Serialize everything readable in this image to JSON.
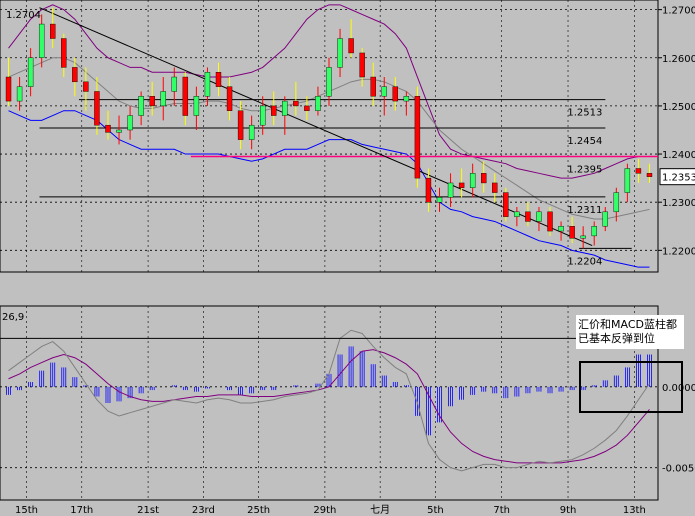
{
  "chart_data": [
    {
      "type": "candlestick",
      "panel": "price",
      "ylim": [
        1.2155,
        1.272
      ],
      "yticks": [
        "1.2700",
        "1.2600",
        "1.2500",
        "1.2400",
        "1.2300",
        "1.2200"
      ],
      "xticks": [
        "15th",
        "17th",
        "21st",
        "23rd",
        "25th",
        "29th",
        "七月",
        "5th",
        "7th",
        "9th",
        "13th"
      ],
      "candles": [
        [
          1.256,
          1.26,
          1.25,
          1.251
        ],
        [
          1.251,
          1.256,
          1.249,
          1.254
        ],
        [
          1.254,
          1.262,
          1.252,
          1.26
        ],
        [
          1.26,
          1.269,
          1.258,
          1.267
        ],
        [
          1.267,
          1.2704,
          1.262,
          1.264
        ],
        [
          1.264,
          1.265,
          1.256,
          1.258
        ],
        [
          1.258,
          1.26,
          1.252,
          1.255
        ],
        [
          1.255,
          1.258,
          1.249,
          1.253
        ],
        [
          1.253,
          1.256,
          1.244,
          1.246
        ],
        [
          1.246,
          1.249,
          1.243,
          1.2445
        ],
        [
          1.2445,
          1.248,
          1.242,
          1.245
        ],
        [
          1.245,
          1.25,
          1.243,
          1.248
        ],
        [
          1.248,
          1.253,
          1.246,
          1.252
        ],
        [
          1.252,
          1.255,
          1.248,
          1.25
        ],
        [
          1.25,
          1.256,
          1.247,
          1.253
        ],
        [
          1.253,
          1.258,
          1.25,
          1.256
        ],
        [
          1.256,
          1.257,
          1.246,
          1.248
        ],
        [
          1.248,
          1.254,
          1.245,
          1.252
        ],
        [
          1.252,
          1.258,
          1.25,
          1.257
        ],
        [
          1.257,
          1.259,
          1.252,
          1.254
        ],
        [
          1.254,
          1.256,
          1.247,
          1.249
        ],
        [
          1.249,
          1.251,
          1.241,
          1.243
        ],
        [
          1.243,
          1.248,
          1.241,
          1.246
        ],
        [
          1.246,
          1.252,
          1.244,
          1.25
        ],
        [
          1.25,
          1.253,
          1.246,
          1.248
        ],
        [
          1.248,
          1.252,
          1.244,
          1.251
        ],
        [
          1.251,
          1.255,
          1.248,
          1.25
        ],
        [
          1.25,
          1.252,
          1.247,
          1.249
        ],
        [
          1.249,
          1.254,
          1.248,
          1.252
        ],
        [
          1.252,
          1.26,
          1.25,
          1.258
        ],
        [
          1.258,
          1.266,
          1.256,
          1.264
        ],
        [
          1.264,
          1.268,
          1.26,
          1.261
        ],
        [
          1.261,
          1.262,
          1.254,
          1.256
        ],
        [
          1.256,
          1.259,
          1.25,
          1.252
        ],
        [
          1.252,
          1.256,
          1.248,
          1.254
        ],
        [
          1.254,
          1.256,
          1.249,
          1.251
        ],
        [
          1.251,
          1.253,
          1.248,
          1.252
        ],
        [
          1.252,
          1.254,
          1.233,
          1.235
        ],
        [
          1.235,
          1.237,
          1.228,
          1.23
        ],
        [
          1.23,
          1.233,
          1.228,
          1.231
        ],
        [
          1.231,
          1.236,
          1.229,
          1.234
        ],
        [
          1.234,
          1.237,
          1.231,
          1.233
        ],
        [
          1.233,
          1.238,
          1.231,
          1.236
        ],
        [
          1.236,
          1.2385,
          1.232,
          1.234
        ],
        [
          1.234,
          1.236,
          1.23,
          1.232
        ],
        [
          1.232,
          1.233,
          1.226,
          1.227
        ],
        [
          1.227,
          1.229,
          1.225,
          1.228
        ],
        [
          1.228,
          1.23,
          1.225,
          1.226
        ],
        [
          1.226,
          1.229,
          1.224,
          1.228
        ],
        [
          1.228,
          1.229,
          1.223,
          1.224
        ],
        [
          1.224,
          1.226,
          1.222,
          1.225
        ],
        [
          1.225,
          1.227,
          1.2215,
          1.2225
        ],
        [
          1.2225,
          1.225,
          1.2204,
          1.223
        ],
        [
          1.223,
          1.226,
          1.221,
          1.225
        ],
        [
          1.225,
          1.229,
          1.224,
          1.228
        ],
        [
          1.228,
          1.233,
          1.226,
          1.232
        ],
        [
          1.232,
          1.238,
          1.23,
          1.237
        ],
        [
          1.237,
          1.239,
          1.234,
          1.236
        ],
        [
          1.236,
          1.238,
          1.234,
          1.2353
        ]
      ],
      "bollinger_upper": [
        1.262,
        1.265,
        1.268,
        1.27,
        1.271,
        1.27,
        1.268,
        1.265,
        1.262,
        1.26,
        1.259,
        1.258,
        1.258,
        1.257,
        1.257,
        1.257,
        1.257,
        1.2565,
        1.256,
        1.256,
        1.256,
        1.2565,
        1.257,
        1.258,
        1.26,
        1.262,
        1.265,
        1.268,
        1.27,
        1.271,
        1.271,
        1.27,
        1.269,
        1.268,
        1.267,
        1.265,
        1.262,
        1.256,
        1.25,
        1.244,
        1.241,
        1.24,
        1.2395,
        1.239,
        1.2385,
        1.238,
        1.237,
        1.2365,
        1.236,
        1.2355,
        1.235,
        1.235,
        1.2355,
        1.236,
        1.237,
        1.238,
        1.239,
        1.2395,
        1.2395
      ],
      "bollinger_middle": [
        1.256,
        1.257,
        1.258,
        1.259,
        1.26,
        1.26,
        1.259,
        1.257,
        1.255,
        1.253,
        1.251,
        1.25,
        1.2495,
        1.2495,
        1.25,
        1.2505,
        1.2505,
        1.2505,
        1.251,
        1.251,
        1.2505,
        1.2495,
        1.249,
        1.249,
        1.2495,
        1.25,
        1.2505,
        1.251,
        1.252,
        1.253,
        1.254,
        1.255,
        1.2555,
        1.2555,
        1.255,
        1.254,
        1.253,
        1.251,
        1.248,
        1.245,
        1.243,
        1.241,
        1.2395,
        1.238,
        1.2365,
        1.235,
        1.2335,
        1.232,
        1.2305,
        1.2295,
        1.2285,
        1.2275,
        1.227,
        1.2265,
        1.2265,
        1.227,
        1.2275,
        1.228,
        1.2285
      ],
      "bollinger_lower": [
        1.249,
        1.248,
        1.247,
        1.247,
        1.248,
        1.249,
        1.249,
        1.248,
        1.247,
        1.245,
        1.243,
        1.242,
        1.241,
        1.241,
        1.241,
        1.241,
        1.24,
        1.24,
        1.24,
        1.24,
        1.2395,
        1.239,
        1.2385,
        1.239,
        1.24,
        1.241,
        1.241,
        1.241,
        1.242,
        1.243,
        1.243,
        1.243,
        1.242,
        1.2415,
        1.241,
        1.2405,
        1.24,
        1.238,
        1.234,
        1.23,
        1.2285,
        1.228,
        1.227,
        1.2265,
        1.226,
        1.225,
        1.224,
        1.223,
        1.222,
        1.2215,
        1.221,
        1.22,
        1.2195,
        1.219,
        1.218,
        1.2175,
        1.217,
        1.2165,
        1.2165
      ],
      "hlines": [
        {
          "value": 1.2513,
          "label": "1.2513",
          "from": 0.12,
          "to": 0.92
        },
        {
          "value": 1.2454,
          "label": "1.2454",
          "from": 0.06,
          "to": 0.92
        },
        {
          "value": 1.2395,
          "label": "1.2395",
          "from": 0.29,
          "to": 1.0
        },
        {
          "value": 1.2311,
          "label": "1.2311",
          "from": 0.06,
          "to": 0.92
        },
        {
          "value": 1.2204,
          "label": "1.2204",
          "from": 0.88,
          "to": 0.96
        }
      ],
      "trendline": {
        "x1": 0.06,
        "y1": 1.2704,
        "x2": 0.9,
        "y2": 1.221
      },
      "high_label": "1.2704",
      "last_price_label": "1.2353",
      "colors": {
        "bull": "#ff0000",
        "bear": "#ffff00",
        "bull_body": "#33ff66",
        "upper": "#800080",
        "middle": "#808080",
        "lower": "#0000ff",
        "resistance": "#ff0080"
      }
    },
    {
      "type": "macd",
      "panel": "macd",
      "ylim": [
        -0.007,
        0.005
      ],
      "yticks": [
        "0.0000",
        "-0.0050"
      ],
      "indicator_label": "26,9",
      "histogram": [
        -0.0005,
        -0.0002,
        0.0003,
        0.001,
        0.0015,
        0.0012,
        0.0006,
        0.0001,
        -0.0006,
        -0.001,
        -0.0009,
        -0.0007,
        -0.0004,
        -0.0002,
        0.0,
        0.0001,
        -0.0002,
        -0.0003,
        -0.0001,
        0.0,
        -0.0002,
        -0.0005,
        -0.0004,
        -0.0002,
        -0.0002,
        0.0,
        0.0001,
        0.0,
        0.0002,
        0.0008,
        0.002,
        0.0025,
        0.0022,
        0.0014,
        0.0007,
        0.0003,
        0.0001,
        -0.0018,
        -0.003,
        -0.0022,
        -0.0012,
        -0.0008,
        -0.0005,
        -0.0003,
        -0.0004,
        -0.0007,
        -0.0006,
        -0.0004,
        -0.0003,
        -0.0004,
        -0.0003,
        -0.0002,
        -0.0002,
        0.0001,
        0.0004,
        0.0007,
        0.0012,
        0.002,
        0.002
      ],
      "signal": [
        0.0005,
        0.0008,
        0.0012,
        0.0015,
        0.0018,
        0.002,
        0.0018,
        0.0014,
        0.0008,
        0.0002,
        -0.0003,
        -0.0006,
        -0.0008,
        -0.0009,
        -0.0009,
        -0.0008,
        -0.0007,
        -0.0006,
        -0.0006,
        -0.0005,
        -0.0005,
        -0.0005,
        -0.0006,
        -0.0006,
        -0.0006,
        -0.0005,
        -0.0004,
        -0.0003,
        -0.0002,
        0.0,
        0.0008,
        0.0016,
        0.0022,
        0.0023,
        0.0021,
        0.0018,
        0.0014,
        0.0008,
        -0.0005,
        -0.0018,
        -0.0028,
        -0.0035,
        -0.004,
        -0.0043,
        -0.0045,
        -0.0046,
        -0.0047,
        -0.0047,
        -0.0047,
        -0.0047,
        -0.0047,
        -0.0046,
        -0.0045,
        -0.0043,
        -0.004,
        -0.0036,
        -0.003,
        -0.0022,
        -0.0014
      ],
      "macd_line": [
        0.001,
        0.0015,
        0.002,
        0.0025,
        0.0028,
        0.0022,
        0.0012,
        0.0002,
        -0.0008,
        -0.0015,
        -0.0018,
        -0.0016,
        -0.0014,
        -0.0012,
        -0.001,
        -0.0008,
        -0.0009,
        -0.001,
        -0.0008,
        -0.0007,
        -0.0008,
        -0.001,
        -0.001,
        -0.0009,
        -0.0008,
        -0.0006,
        -0.0005,
        -0.0004,
        -0.0002,
        0.0008,
        0.003,
        0.0035,
        0.0033,
        0.0025,
        0.0018,
        0.0012,
        0.0008,
        -0.001,
        -0.0035,
        -0.0045,
        -0.005,
        -0.0052,
        -0.005,
        -0.0048,
        -0.0048,
        -0.005,
        -0.005,
        -0.0048,
        -0.0046,
        -0.0047,
        -0.0046,
        -0.0045,
        -0.0042,
        -0.0038,
        -0.0033,
        -0.0027,
        -0.0018,
        -0.0008,
        0.0002
      ],
      "annotation": [
        "汇价和MACD蓝柱都",
        "已基本反弹到位"
      ],
      "colors": {
        "histogram": "#0000ff",
        "signal": "#800080",
        "macd_line": "#808080"
      }
    }
  ]
}
